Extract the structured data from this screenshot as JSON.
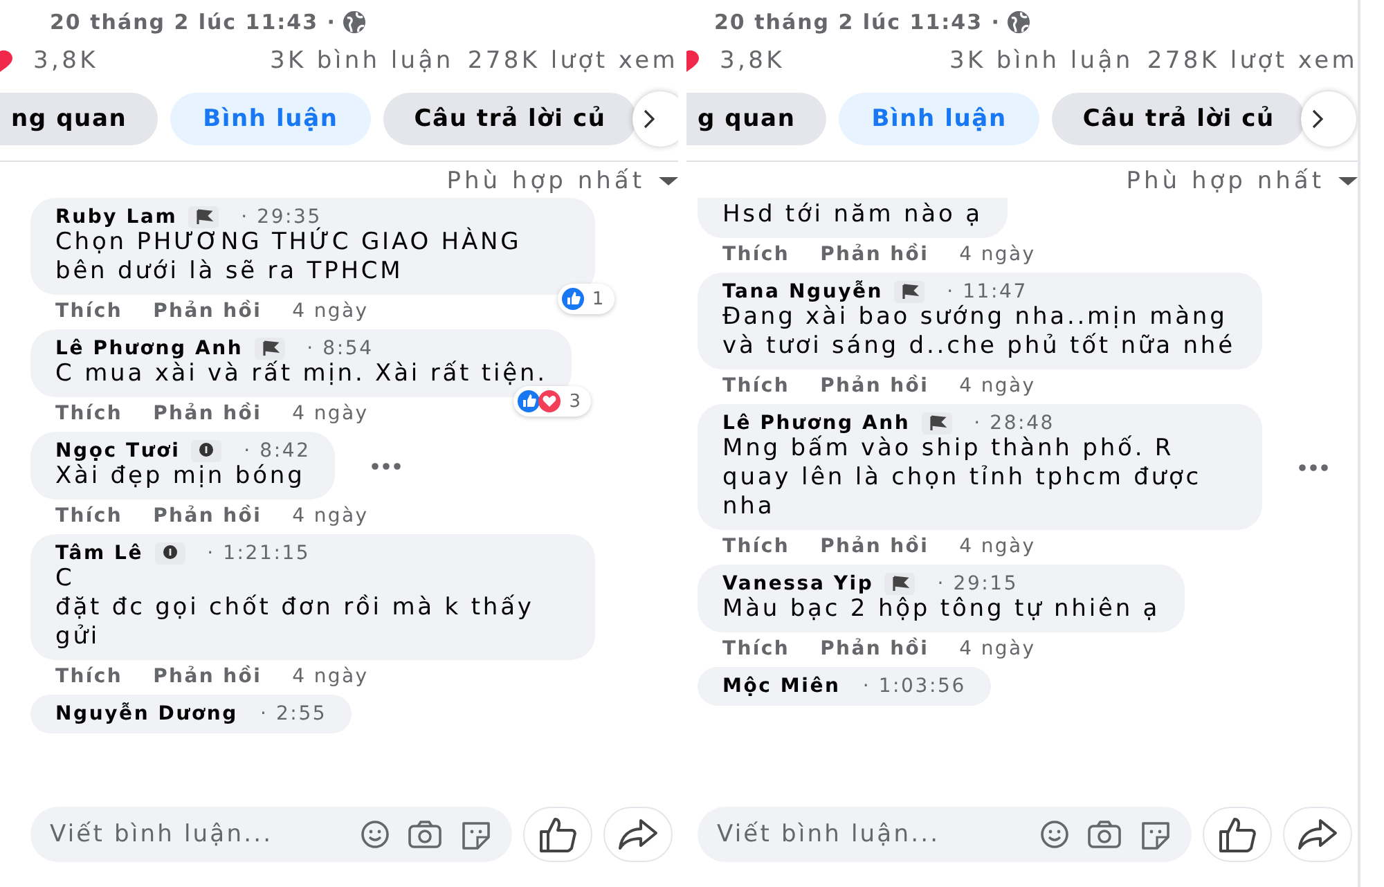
{
  "panels": [
    {
      "date": "20 tháng 2 lúc 11:43 ·",
      "reactions_count": "3,8K",
      "comments_count": "3K bình luận",
      "views": "278K lượt xem",
      "tabs": [
        {
          "label": "ng quan",
          "selected": false
        },
        {
          "label": "Bình luận",
          "selected": true
        },
        {
          "label": "Câu trả lời củ",
          "selected": false
        }
      ],
      "sort": "Phù hợp nhất",
      "comments": [
        {
          "name": "Ruby Lam",
          "badge": {
            "kind": "flag"
          },
          "time": "· 29:35",
          "text": "Chọn PHƯƠNG THỨC GIAO HÀNG bên dưới là sẽ ra TPHCM",
          "like": "Thích",
          "reply": "Phản hồi",
          "age": "4 ngày",
          "reactions": {
            "icons": [
              {
                "kind": "like"
              }
            ],
            "count": "1"
          },
          "more": false
        },
        {
          "name": "Lê Phương Anh",
          "badge": {
            "kind": "flag"
          },
          "time": "· 8:54",
          "text": "C mua xài và rất mịn. Xài rất tiện.",
          "like": "Thích",
          "reply": "Phản hồi",
          "age": "4 ngày",
          "reactions": {
            "icons": [
              {
                "kind": "like"
              },
              {
                "kind": "love"
              }
            ],
            "count": "3"
          },
          "more": false
        },
        {
          "name": "Ngọc Tươi",
          "badge": {
            "kind": "info"
          },
          "time": "· 8:42",
          "text": "Xài đẹp mịn bóng",
          "like": "Thích",
          "reply": "Phản hồi",
          "age": "4 ngày",
          "more": true
        },
        {
          "name": "Tâm Lê",
          "badge": {
            "kind": "info"
          },
          "time": "· 1:21:15",
          "text": "C\nđặt đc gọi chốt đơn rồi mà k thấy gửi",
          "like": "Thích",
          "reply": "Phản hồi",
          "age": "4 ngày",
          "more": false
        },
        {
          "name": "Nguyễn Dương",
          "time": "· 2:55",
          "more": false
        }
      ],
      "composer": {
        "placeholder": "Viết bình luận..."
      }
    },
    {
      "date": "20 tháng 2 lúc 11:43 ·",
      "reactions_count": "3,8K",
      "comments_count": "3K bình luận",
      "views": "278K lượt xem",
      "tabs": [
        {
          "label": "g quan",
          "selected": false
        },
        {
          "label": "Bình luận",
          "selected": true
        },
        {
          "label": "Câu trả lời củ",
          "selected": false
        }
      ],
      "sort": "Phù hợp nhất",
      "comments": [
        {
          "text": "Hsd tới năm nào ạ",
          "like": "Thích",
          "reply": "Phản hồi",
          "age": "4 ngày",
          "more": false
        },
        {
          "name": "Tana Nguyễn",
          "badge": {
            "kind": "flag"
          },
          "time": "· 11:47",
          "text": "Đang xài bao sướng nha..mịn màng và tươi sáng d..che phủ tốt nữa nhé",
          "like": "Thích",
          "reply": "Phản hồi",
          "age": "4 ngày",
          "more": false
        },
        {
          "name": "Lê Phương Anh",
          "badge": {
            "kind": "flag"
          },
          "time": "· 28:48",
          "text": "Mng bấm vào ship thành phố. R quay lên là chọn tỉnh tphcm được nha",
          "like": "Thích",
          "reply": "Phản hồi",
          "age": "4 ngày",
          "more": true
        },
        {
          "name": "Vanessa Yip",
          "badge": {
            "kind": "flag"
          },
          "time": "· 29:15",
          "text": "Màu bạc 2 hộp tông tự nhiên ạ",
          "like": "Thích",
          "reply": "Phản hồi",
          "age": "4 ngày",
          "more": false
        },
        {
          "name": "Mộc Miên",
          "time": "· 1:03:56",
          "more": false
        }
      ],
      "composer": {
        "placeholder": "Viết bình luận..."
      }
    }
  ]
}
